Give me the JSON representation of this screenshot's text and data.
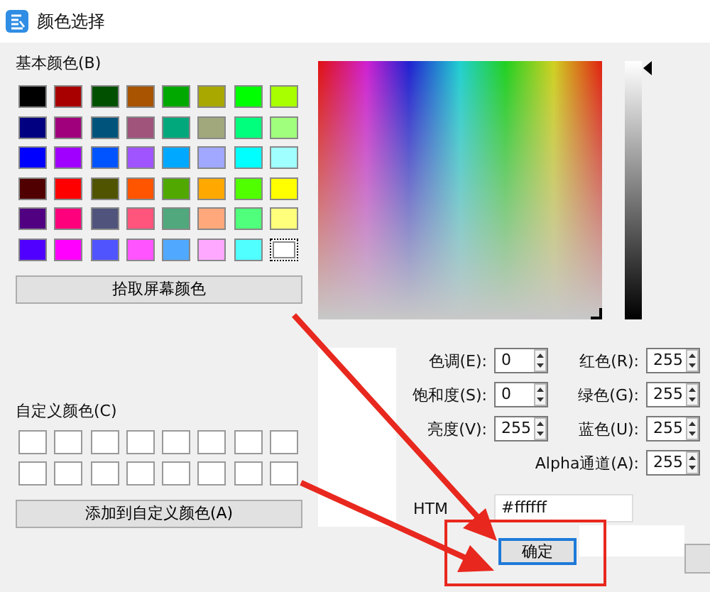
{
  "window": {
    "title": "颜色选择"
  },
  "basic_colors": {
    "label": "基本颜色(B)",
    "swatches": [
      {
        "color": "#000000",
        "selected": false
      },
      {
        "color": "#a80000",
        "selected": false
      },
      {
        "color": "#005000",
        "selected": false
      },
      {
        "color": "#a85400",
        "selected": false
      },
      {
        "color": "#00a800",
        "selected": false
      },
      {
        "color": "#a8a800",
        "selected": false
      },
      {
        "color": "#00ff00",
        "selected": false
      },
      {
        "color": "#a8ff00",
        "selected": false
      },
      {
        "color": "#000080",
        "selected": false
      },
      {
        "color": "#a0007c",
        "selected": false
      },
      {
        "color": "#00547c",
        "selected": false
      },
      {
        "color": "#a0547c",
        "selected": false
      },
      {
        "color": "#00a87c",
        "selected": false
      },
      {
        "color": "#a0a87c",
        "selected": false
      },
      {
        "color": "#00ff7c",
        "selected": false
      },
      {
        "color": "#a0ff7c",
        "selected": false
      },
      {
        "color": "#0000ff",
        "selected": false
      },
      {
        "color": "#a000ff",
        "selected": false
      },
      {
        "color": "#0054ff",
        "selected": false
      },
      {
        "color": "#a054ff",
        "selected": false
      },
      {
        "color": "#00a8ff",
        "selected": false
      },
      {
        "color": "#a0a8ff",
        "selected": false
      },
      {
        "color": "#00ffff",
        "selected": false
      },
      {
        "color": "#a0ffff",
        "selected": false
      },
      {
        "color": "#500000",
        "selected": false
      },
      {
        "color": "#ff0000",
        "selected": false
      },
      {
        "color": "#505400",
        "selected": false
      },
      {
        "color": "#ff5400",
        "selected": false
      },
      {
        "color": "#50a800",
        "selected": false
      },
      {
        "color": "#ffa800",
        "selected": false
      },
      {
        "color": "#50ff00",
        "selected": false
      },
      {
        "color": "#ffff00",
        "selected": false
      },
      {
        "color": "#500080",
        "selected": false
      },
      {
        "color": "#ff007c",
        "selected": false
      },
      {
        "color": "#50547c",
        "selected": false
      },
      {
        "color": "#ff547c",
        "selected": false
      },
      {
        "color": "#50a87c",
        "selected": false
      },
      {
        "color": "#ffa87c",
        "selected": false
      },
      {
        "color": "#50ff7c",
        "selected": false
      },
      {
        "color": "#ffff7c",
        "selected": false
      },
      {
        "color": "#5000ff",
        "selected": false
      },
      {
        "color": "#ff00ff",
        "selected": false
      },
      {
        "color": "#5054ff",
        "selected": false
      },
      {
        "color": "#ff54ff",
        "selected": false
      },
      {
        "color": "#50a8ff",
        "selected": false
      },
      {
        "color": "#ffa8ff",
        "selected": false
      },
      {
        "color": "#50ffff",
        "selected": false
      },
      {
        "color": "#ffffff",
        "selected": true
      }
    ]
  },
  "pick_screen_button": "拾取屏幕颜色",
  "custom_colors": {
    "label": "自定义颜色(C)",
    "swatches": [
      {
        "color": "#ffffff"
      },
      {
        "color": "#ffffff"
      },
      {
        "color": "#ffffff"
      },
      {
        "color": "#ffffff"
      },
      {
        "color": "#ffffff"
      },
      {
        "color": "#ffffff"
      },
      {
        "color": "#ffffff"
      },
      {
        "color": "#ffffff"
      },
      {
        "color": "#ffffff"
      },
      {
        "color": "#ffffff"
      },
      {
        "color": "#ffffff"
      },
      {
        "color": "#ffffff"
      },
      {
        "color": "#ffffff"
      },
      {
        "color": "#ffffff"
      },
      {
        "color": "#ffffff"
      },
      {
        "color": "#ffffff"
      }
    ]
  },
  "add_custom_button": "添加到自定义颜色(A)",
  "spin_rows": [
    {
      "left": {
        "label": "色调(E):",
        "value": "0"
      },
      "right": {
        "label": "红色(R):",
        "value": "255"
      }
    },
    {
      "left": {
        "label": "饱和度(S):",
        "value": "0"
      },
      "right": {
        "label": "绿色(G):",
        "value": "255"
      }
    },
    {
      "left": {
        "label": "亮度(V):",
        "value": "255"
      },
      "right": {
        "label": "蓝色(U):",
        "value": "255"
      }
    },
    {
      "right": {
        "label": "Alpha通道(A):",
        "value": "255"
      }
    }
  ],
  "html": {
    "label": "HTM",
    "value": "#ffffff"
  },
  "ok_button": "确定"
}
